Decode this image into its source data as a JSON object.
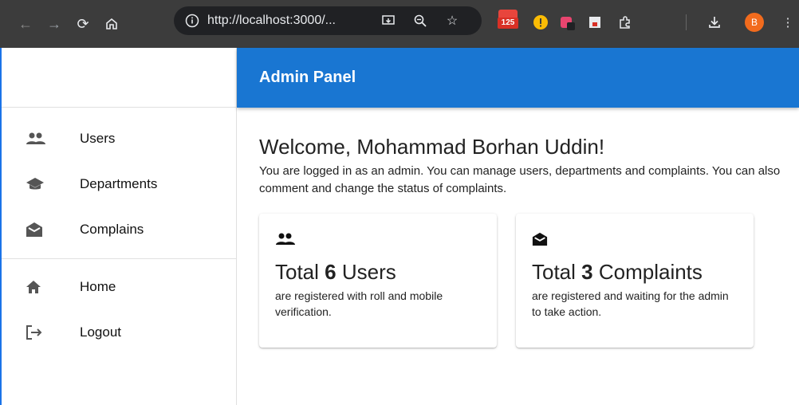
{
  "browser": {
    "url": "http://localhost:3000/...",
    "extension_badge": "125",
    "profile_initial": "B"
  },
  "app": {
    "title": "Admin Panel"
  },
  "sidebar": {
    "items": [
      {
        "label": "Users",
        "icon": "people-icon"
      },
      {
        "label": "Departments",
        "icon": "school-icon"
      },
      {
        "label": "Complains",
        "icon": "drafts-icon"
      }
    ],
    "secondary": [
      {
        "label": "Home",
        "icon": "home-icon"
      },
      {
        "label": "Logout",
        "icon": "logout-icon"
      }
    ]
  },
  "main": {
    "welcome": "Welcome, Mohammad Borhan Uddin!",
    "subtext": "You are logged in as an admin. You can manage users, departments and complaints. You can also comment and change the status of complaints.",
    "cards": [
      {
        "prefix": "Total ",
        "count": "6",
        "suffix": " Users",
        "desc": "are registered with roll and mobile verification.",
        "icon": "people-icon"
      },
      {
        "prefix": "Total ",
        "count": "3",
        "suffix": " Complaints",
        "desc": "are registered and waiting for the admin to take action.",
        "icon": "drafts-icon"
      }
    ]
  },
  "colors": {
    "appbar": "#1976d2",
    "chrome": "#3c3c3c"
  }
}
